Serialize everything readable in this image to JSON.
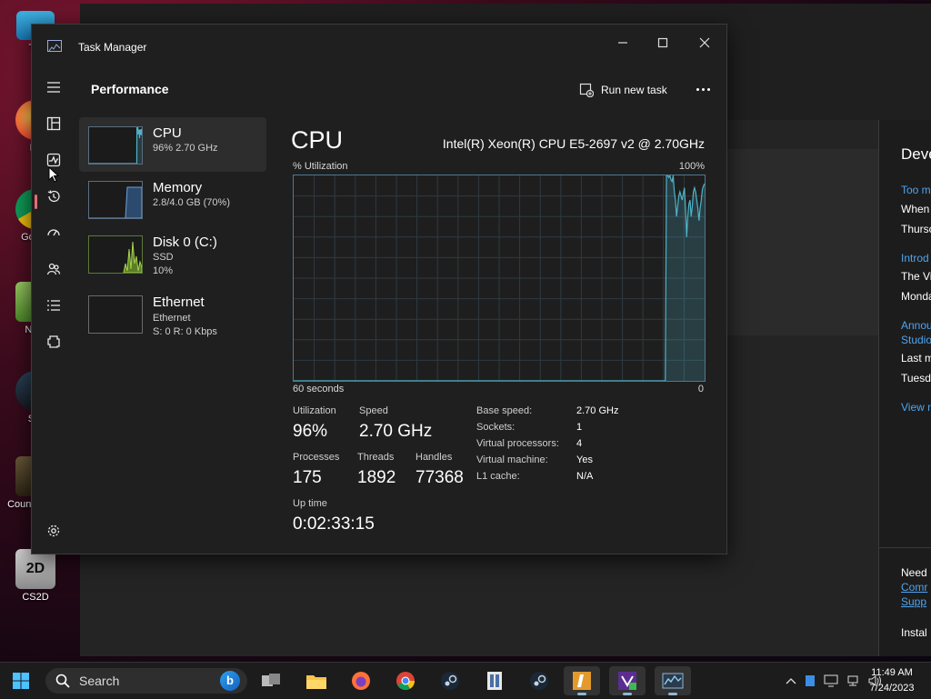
{
  "desktop": {
    "icons": [
      {
        "label": "Thi",
        "icon": "this-pc-icon"
      },
      {
        "label": "Fir",
        "icon": "firefox-icon"
      },
      {
        "label": "Go Ch",
        "icon": "chrome-icon"
      },
      {
        "label": "Note",
        "icon": "notepad-icon"
      },
      {
        "label": "Ste",
        "icon": "steam-icon"
      },
      {
        "label": "Count Globa",
        "icon": "counter-strike-icon"
      },
      {
        "label": "CS2D",
        "icon": "cs2d-icon"
      }
    ]
  },
  "background_window": {
    "right_pane": {
      "title": "Deve",
      "lines": [
        {
          "text": "Too m",
          "link": true
        },
        {
          "text": "When",
          "link": false
        },
        {
          "text": "Thursc",
          "link": false
        },
        {
          "text": "Introd",
          "link": true
        },
        {
          "text": "The Vi",
          "link": false
        },
        {
          "text": "Monda",
          "link": false
        },
        {
          "text": "Annou",
          "link": true
        },
        {
          "text": "Studio",
          "link": true
        },
        {
          "text": "Last m",
          "link": false
        },
        {
          "text": "Tuesda",
          "link": false
        },
        {
          "text": "View n",
          "link": true
        }
      ],
      "footer": [
        {
          "text": "Need",
          "link": false
        },
        {
          "text": "Comr",
          "link": true
        },
        {
          "text": "Supp",
          "link": true
        },
        {
          "text": "Instal",
          "link": false
        }
      ]
    }
  },
  "task_manager": {
    "title": "Task Manager",
    "page_title": "Performance",
    "run_new_task": "Run new task",
    "nav_icons": [
      "hamburger-icon",
      "processes-icon",
      "performance-icon",
      "app-history-icon",
      "startup-apps-icon",
      "users-icon",
      "details-icon",
      "services-icon",
      "settings-icon"
    ],
    "resources": [
      {
        "name": "CPU",
        "lines": [
          "96% 2.70 GHz"
        ],
        "selected": true,
        "thumb_color": "#4fb3c8"
      },
      {
        "name": "Memory",
        "lines": [
          "2.8/4.0 GB (70%)"
        ],
        "selected": false,
        "thumb_color": "#4f7fb8"
      },
      {
        "name": "Disk 0 (C:)",
        "lines": [
          "SSD",
          "10%"
        ],
        "selected": false,
        "thumb_color": "#8ab83a"
      },
      {
        "name": "Ethernet",
        "lines": [
          "Ethernet",
          "S: 0 R: 0 Kbps"
        ],
        "selected": false,
        "thumb_color": "#b0763a"
      }
    ],
    "detail": {
      "title": "CPU",
      "model": "Intel(R) Xeon(R) CPU E5-2697 v2 @ 2.70GHz",
      "graph_label_left": "% Utilization",
      "graph_label_right": "100%",
      "graph_bottom_left": "60 seconds",
      "graph_bottom_right": "0",
      "graph_color": "#4fb3c8",
      "cpu_history_percent": [
        0,
        0,
        0,
        0,
        0,
        0,
        0,
        0,
        0,
        0,
        0,
        0,
        0,
        0,
        0,
        0,
        0,
        0,
        0,
        0,
        0,
        0,
        0,
        0,
        0,
        0,
        0,
        0,
        0,
        0,
        0,
        0,
        0,
        0,
        0,
        0,
        0,
        0,
        0,
        0,
        0,
        0,
        0,
        0,
        0,
        0,
        0,
        0,
        0,
        0,
        0,
        0,
        0,
        0,
        0,
        0,
        0,
        0,
        0,
        0,
        0,
        0,
        0,
        0,
        0,
        0,
        0,
        0,
        0,
        0,
        0,
        0,
        0,
        0,
        0,
        0,
        0,
        0,
        0,
        0,
        0,
        0,
        0,
        0,
        0,
        0,
        0,
        0,
        0,
        0,
        0,
        0,
        0,
        0,
        0,
        0,
        0,
        0,
        0,
        0,
        0,
        0,
        0,
        0,
        0,
        0,
        0,
        0,
        0,
        0,
        0,
        0,
        0,
        0,
        0,
        0,
        0,
        0,
        0,
        0,
        0,
        0,
        0,
        0,
        0,
        0,
        0,
        0,
        0,
        0,
        0,
        0,
        0,
        0,
        0,
        0,
        0,
        0,
        0,
        0,
        0,
        0,
        0,
        0,
        0,
        0,
        0,
        0,
        0,
        0,
        0,
        0,
        0,
        0,
        0,
        0,
        0,
        0,
        0,
        0,
        0,
        0,
        0,
        0,
        0,
        0,
        0,
        0,
        0,
        0,
        0,
        0,
        0,
        0,
        0,
        0,
        0,
        0,
        0,
        0,
        0,
        0,
        0,
        0,
        0,
        0,
        0,
        0,
        0,
        0,
        0,
        0,
        0,
        0,
        0,
        0,
        0,
        0,
        0,
        0,
        0,
        0,
        0,
        0,
        0,
        0,
        0,
        0,
        0,
        0,
        0,
        0,
        0,
        0,
        0,
        0,
        0,
        0,
        0,
        0,
        0,
        0,
        0,
        0,
        0,
        0,
        0,
        0,
        0,
        0,
        0,
        0,
        0,
        0,
        0,
        0,
        0,
        0,
        0,
        0,
        0,
        0,
        0,
        0,
        0,
        0,
        0,
        0,
        0,
        0,
        0,
        0,
        0,
        0,
        0,
        0,
        0,
        0,
        0,
        0,
        0,
        0,
        0,
        0,
        0,
        0,
        0,
        0,
        0,
        0,
        0,
        0,
        0,
        0,
        0,
        0,
        0,
        0,
        0,
        0,
        0,
        0,
        0,
        0,
        0,
        0,
        0,
        0,
        0,
        0,
        0,
        0,
        0,
        0,
        0,
        0,
        0,
        0,
        0,
        0,
        0,
        0,
        0,
        0,
        0,
        0,
        0,
        0,
        0,
        0,
        0,
        0,
        0,
        0,
        0,
        0,
        0,
        0,
        0,
        0,
        0,
        0,
        0,
        0,
        0,
        0,
        0,
        0,
        0,
        0,
        0,
        0,
        100,
        100,
        99,
        100,
        98,
        97,
        100,
        92,
        88,
        80,
        85,
        90,
        92,
        90,
        88,
        91,
        94,
        84,
        70,
        80,
        86,
        88,
        80,
        85,
        92,
        94,
        92,
        88,
        84,
        78,
        84,
        88,
        93,
        95,
        96
      ],
      "stats": {
        "utilization_label": "Utilization",
        "utilization": "96%",
        "speed_label": "Speed",
        "speed": "2.70 GHz",
        "processes_label": "Processes",
        "processes": "175",
        "threads_label": "Threads",
        "threads": "1892",
        "handles_label": "Handles",
        "handles": "77368",
        "uptime_label": "Up time",
        "uptime": "0:02:33:15"
      },
      "specs": [
        {
          "label": "Base speed:",
          "value": "2.70 GHz"
        },
        {
          "label": "Sockets:",
          "value": "1"
        },
        {
          "label": "Virtual processors:",
          "value": "4"
        },
        {
          "label": "Virtual machine:",
          "value": "Yes"
        },
        {
          "label": "L1 cache:",
          "value": "N/A"
        }
      ]
    }
  },
  "taskbar": {
    "search_placeholder": "Search",
    "apps": [
      "task-view-icon",
      "file-explorer-icon",
      "firefox-icon",
      "chrome-icon",
      "steam-icon",
      "book-app-icon",
      "steam-icon",
      "cs-app-icon",
      "visual-studio-installer-icon",
      "task-manager-icon"
    ],
    "time": "11:49 AM",
    "date": "7/24/2023"
  }
}
